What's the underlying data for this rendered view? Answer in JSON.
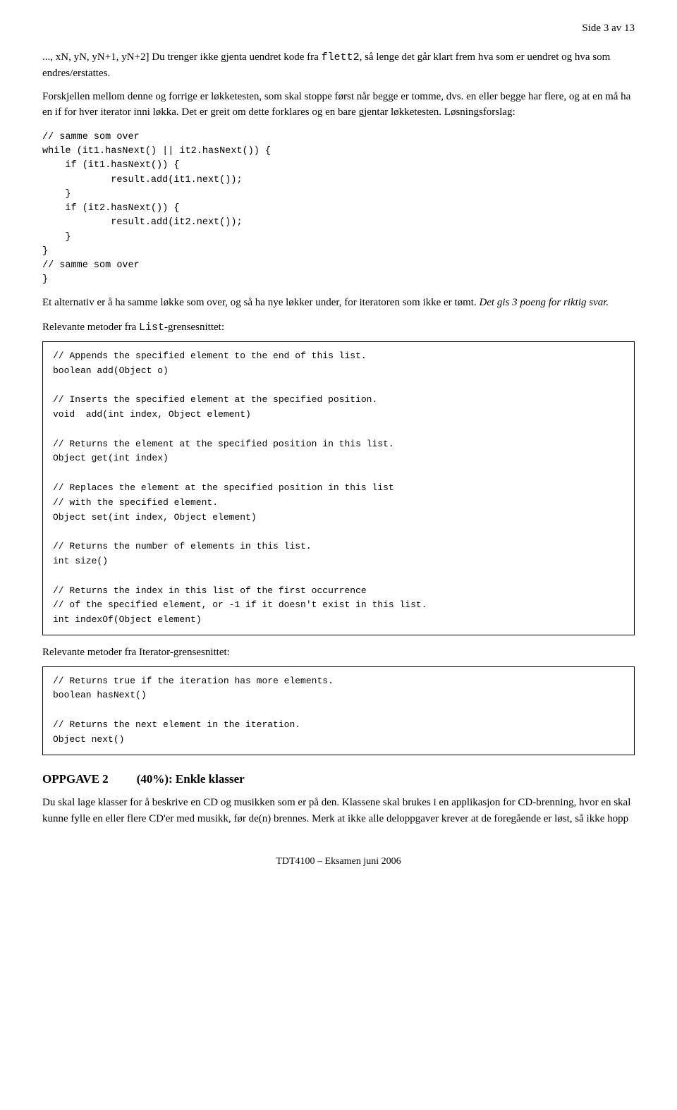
{
  "header": {
    "text": "Side 3 av 13"
  },
  "intro_paragraph1": "..., xN, yN, yN+1, yN+2] Du trenger ikke gjenta uendret kode fra flett2, så lenge det går klart frem hva som er uendret og hva som endres/erstattes.",
  "intro_paragraph1_code": "flett2",
  "paragraph2": "Forskjellen mellom denne og forrige er løkketesten, som skal stoppe først når begge er tomme, dvs. en eller begge har flere, og at en må ha en if for hver iterator inni løkka. Det er greit om dette forklares og en bare gjentar løkketesten. Løsningsforslag:",
  "code_solution": "// samme som over\nwhile (it1.hasNext() || it2.hasNext()) {\n    if (it1.hasNext()) {\n            result.add(it1.next());\n    }\n    if (it2.hasNext()) {\n            result.add(it2.next());\n    }\n}\n// samme som over\n}",
  "paragraph3": "Et alternativ er å ha samme løkke som over, og så ha nye løkker under, for iteratoren som ikke er tømt.",
  "paragraph3_italic": "Det gis 3 poeng for riktig svar.",
  "list_section_heading": "Relevante metoder fra List-grensesnittet:",
  "list_box_content": "// Appends the specified element to the end of this list.\nboolean add(Object o)\n\n// Inserts the specified element at the specified position.\nvoid  add(int index, Object element)\n\n// Returns the element at the specified position in this list.\nObject get(int index)\n\n// Replaces the element at the specified position in this list\n// with the specified element.\nObject set(int index, Object element)\n\n// Returns the number of elements in this list.\nint size()\n\n// Returns the index in this list of the first occurrence\n// of the specified element, or -1 if it doesn't exist in this list.\nint indexOf(Object element)",
  "iterator_section_heading": "Relevante metoder fra Iterator-grensesnittet:",
  "iterator_box_content": "// Returns true if the iteration has more elements.\nboolean hasNext()\n\n// Returns the next element in the iteration.\nObject next()",
  "oppgave2_label": "OPPGAVE 2",
  "oppgave2_points": "(40%):",
  "oppgave2_title": "Enkle klasser",
  "oppgave2_paragraph1": "Du skal lage klasser for å beskrive en CD og musikken som er på den. Klassene skal brukes i en applikasjon for CD-brenning, hvor en skal kunne fylle en eller flere CD'er med musikk, før de(n) brennes. Merk at ikke alle deloppgaver krever at de foregående er løst, så ikke hopp",
  "footer": "TDT4100 – Eksamen juni 2006"
}
